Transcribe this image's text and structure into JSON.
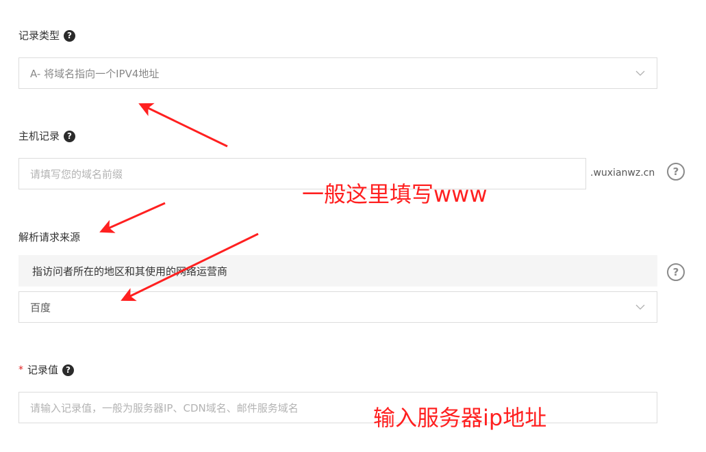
{
  "record_type": {
    "label": "记录类型",
    "help_icon": "question-circle-filled-icon",
    "selected": "A- 将域名指向一个IPV4地址",
    "dropdown_icon": "chevron-down-icon"
  },
  "host_record": {
    "label": "主机记录",
    "help_icon": "question-circle-filled-icon",
    "placeholder": "请填写您的域名前缀",
    "domain_suffix": ".wuxianwz.cn",
    "side_help_icon": "question-circle-outline-icon"
  },
  "resolve_source": {
    "label": "解析请求来源",
    "hint": "指访问者所在的地区和其使用的网络运营商",
    "selected": "百度",
    "side_help_icon": "question-circle-outline-icon",
    "dropdown_icon": "chevron-down-icon"
  },
  "record_value": {
    "required_mark": "*",
    "label": "记录值",
    "help_icon": "question-circle-filled-icon",
    "placeholder": "请输入记录值，一般为服务器IP、CDN域名、邮件服务域名"
  },
  "annotations": {
    "host_note": "一般这里填写www",
    "value_note": "输入服务器ip地址",
    "color": "#ff2020"
  },
  "colors": {
    "border": "#dcdcdc",
    "hint_bg": "#f5f5f5",
    "required": "#e02020"
  }
}
